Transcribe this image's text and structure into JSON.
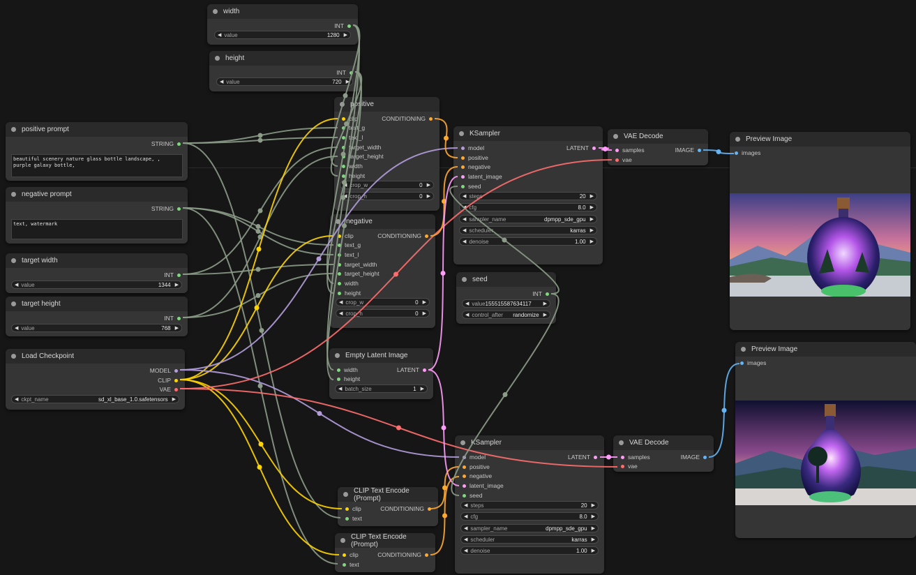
{
  "colors": {
    "canvas": "#161616",
    "node": "#353535",
    "title_bar": "#2a2a2a",
    "int": "#7fd87f",
    "string": "#7fd87f",
    "model": "#b39ddb",
    "clip": "#ffd500",
    "vae": "#ff6e6e",
    "conditioning": "#ffa931",
    "latent": "#ff9cf9",
    "image": "#64b5f6",
    "wire_gray": "#8c9c88"
  },
  "nodes": {
    "width": {
      "title": "width",
      "out_label": "INT",
      "value_label": "value",
      "value": "1280"
    },
    "height": {
      "title": "height",
      "out_label": "INT",
      "value_label": "value",
      "value": "720"
    },
    "positive_prompt": {
      "title": "positive prompt",
      "out_label": "STRING",
      "text": "beautiful scenery nature glass bottle landscape, , purple galaxy bottle,"
    },
    "negative_prompt": {
      "title": "negative prompt",
      "out_label": "STRING",
      "text": "text, watermark"
    },
    "target_width": {
      "title": "target width",
      "out_label": "INT",
      "value_label": "value",
      "value": "1344"
    },
    "target_height": {
      "title": "target height",
      "out_label": "INT",
      "value_label": "value",
      "value": "768"
    },
    "load_checkpoint": {
      "title": "Load Checkpoint",
      "out_model": "MODEL",
      "out_clip": "CLIP",
      "out_vae": "VAE",
      "ckpt_label": "ckpt_name",
      "ckpt_value": "sd_xl_base_1.0.safetensors"
    },
    "positive": {
      "title": "positive",
      "out_label": "CONDITIONING",
      "inputs": [
        "clip",
        "text_g",
        "text_l",
        "target_width",
        "target_height",
        "width",
        "height"
      ],
      "crop_w_label": "crop_w",
      "crop_w": "0",
      "crop_h_label": "crop_h",
      "crop_h": "0"
    },
    "negative": {
      "title": "negative",
      "out_label": "CONDITIONING",
      "inputs": [
        "clip",
        "text_g",
        "text_l",
        "target_width",
        "target_height",
        "width",
        "height"
      ],
      "crop_w_label": "crop_w",
      "crop_w": "0",
      "crop_h_label": "crop_h",
      "crop_h": "0"
    },
    "empty_latent": {
      "title": "Empty Latent Image",
      "in_width": "width",
      "in_height": "height",
      "out_label": "LATENT",
      "batch_label": "batch_size",
      "batch_size": "1"
    },
    "clip_encode_1": {
      "title": "CLIP Text Encode (Prompt)",
      "in_clip": "clip",
      "in_text": "text",
      "out_label": "CONDITIONING"
    },
    "clip_encode_2": {
      "title": "CLIP Text Encode (Prompt)",
      "in_clip": "clip",
      "in_text": "text",
      "out_label": "CONDITIONING"
    },
    "ksampler_1": {
      "title": "KSampler",
      "out_label": "LATENT",
      "inputs": [
        "model",
        "positive",
        "negative",
        "latent_image",
        "seed"
      ],
      "widgets": [
        {
          "label": "steps",
          "value": "20"
        },
        {
          "label": "cfg",
          "value": "8.0"
        },
        {
          "label": "sampler_name",
          "value": "dpmpp_sde_gpu"
        },
        {
          "label": "scheduler",
          "value": "karras"
        },
        {
          "label": "denoise",
          "value": "1.00"
        }
      ]
    },
    "ksampler_2": {
      "title": "KSampler",
      "out_label": "LATENT",
      "inputs": [
        "model",
        "positive",
        "negative",
        "latent_image",
        "seed"
      ],
      "widgets": [
        {
          "label": "steps",
          "value": "20"
        },
        {
          "label": "cfg",
          "value": "8.0"
        },
        {
          "label": "sampler_name",
          "value": "dpmpp_sde_gpu"
        },
        {
          "label": "scheduler",
          "value": "karras"
        },
        {
          "label": "denoise",
          "value": "1.00"
        }
      ]
    },
    "seed": {
      "title": "seed",
      "out_label": "INT",
      "value_label": "value",
      "value": "155515587634117",
      "control_label": "control_after",
      "control_value": "randomize"
    },
    "vae_decode_1": {
      "title": "VAE Decode",
      "in_samples": "samples",
      "in_vae": "vae",
      "out_label": "IMAGE"
    },
    "vae_decode_2": {
      "title": "VAE Decode",
      "in_samples": "samples",
      "in_vae": "vae",
      "out_label": "IMAGE"
    },
    "preview_1": {
      "title": "Preview Image",
      "in_images": "images"
    },
    "preview_2": {
      "title": "Preview Image",
      "in_images": "images"
    }
  }
}
